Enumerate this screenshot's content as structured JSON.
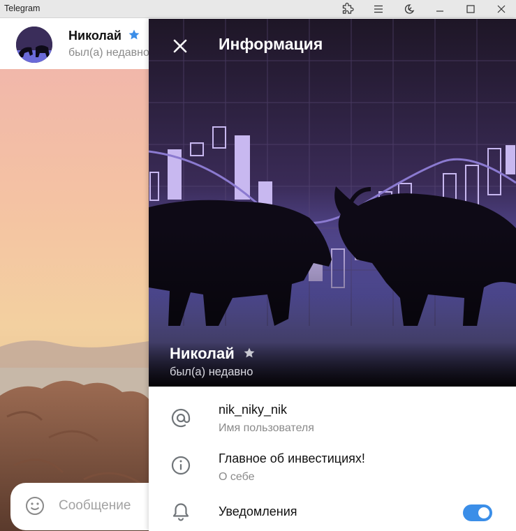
{
  "window": {
    "title": "Telegram"
  },
  "chat": {
    "contact_name": "Николай",
    "contact_status": "был(а) недавно",
    "composer_placeholder": "Сообщение"
  },
  "info": {
    "title": "Информация",
    "name": "Николай",
    "status": "был(а) недавно",
    "username": "nik_niky_nik",
    "username_label": "Имя пользователя",
    "bio": "Главное об инвестициях!",
    "bio_label": "О себе",
    "notifications_label": "Уведомления",
    "notifications_enabled": true
  },
  "colors": {
    "accent": "#3b8ee8",
    "premium_star_chat": "#3b8ee8",
    "premium_star_cover": "#c9c9d2"
  },
  "icons": {
    "titlebar": [
      "puzzle-icon",
      "menu-icon",
      "night-mode-icon",
      "minimize-icon",
      "maximize-icon",
      "close-window-icon"
    ],
    "rows": [
      "at-sign-icon",
      "info-icon",
      "bell-icon"
    ]
  }
}
